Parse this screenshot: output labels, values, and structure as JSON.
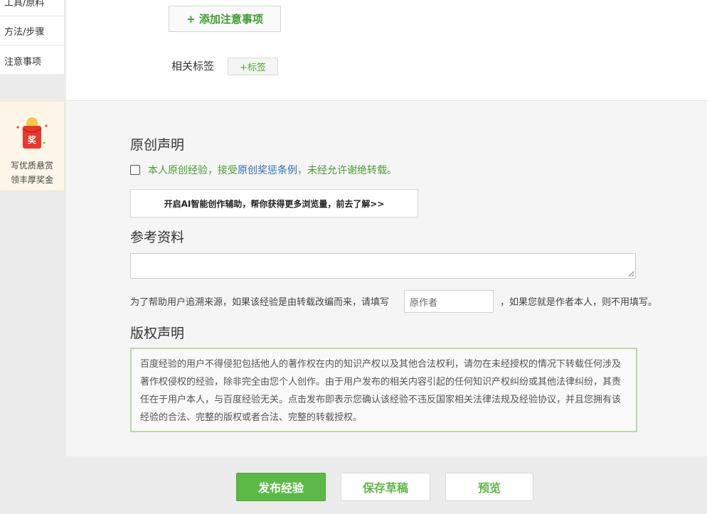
{
  "sidebar": {
    "items": [
      {
        "label": "工具/原料"
      },
      {
        "label": "方法/步骤"
      },
      {
        "label": "注意事项"
      }
    ],
    "reward": {
      "badge": "奖",
      "line1": "写优质悬赏",
      "line2": "领丰厚奖金"
    }
  },
  "notes": {
    "add_button": "+ 添加注意事项",
    "tags_label": "相关标签",
    "tag_button": "+标签"
  },
  "original": {
    "heading": "原创声明",
    "text_before": "本人原创经验，接受",
    "link_text": "原创奖惩条例",
    "text_after": "，未经允许谢绝转载。",
    "checked": false
  },
  "ai_banner": "开启AI智能创作辅助，帮你获得更多浏览量，前去了解>>",
  "reference": {
    "heading": "参考资料",
    "textarea_value": "",
    "source_prefix": "为了帮助用户追溯来源，如果该经验是由转载改编而来，请填写",
    "author_placeholder": "原作者",
    "source_suffix": "，如果您就是作者本人，则不用填写。"
  },
  "copyright": {
    "heading": "版权声明",
    "body": "百度经验的用户不得侵犯包括他人的著作权在内的知识产权以及其他合法权利，请勿在未经授权的情况下转载任何涉及著作权侵权的经验，除非完全由您个人创作。由于用户发布的相关内容引起的任何知识产权纠纷或其他法律纠纷，其责任在于用户本人，与百度经验无关。点击发布即表示您确认该经验不违反国家相关法律法规及经验协议，并且您拥有该经验的合法、完整的版权或者合法、完整的转载授权。"
  },
  "actions": {
    "publish": "发布经验",
    "save_draft": "保存草稿",
    "preview": "预览"
  },
  "colors": {
    "accent_green": "#5cb946",
    "link_blue": "#2f6fb8",
    "copyright_border": "#b5d9a6"
  }
}
